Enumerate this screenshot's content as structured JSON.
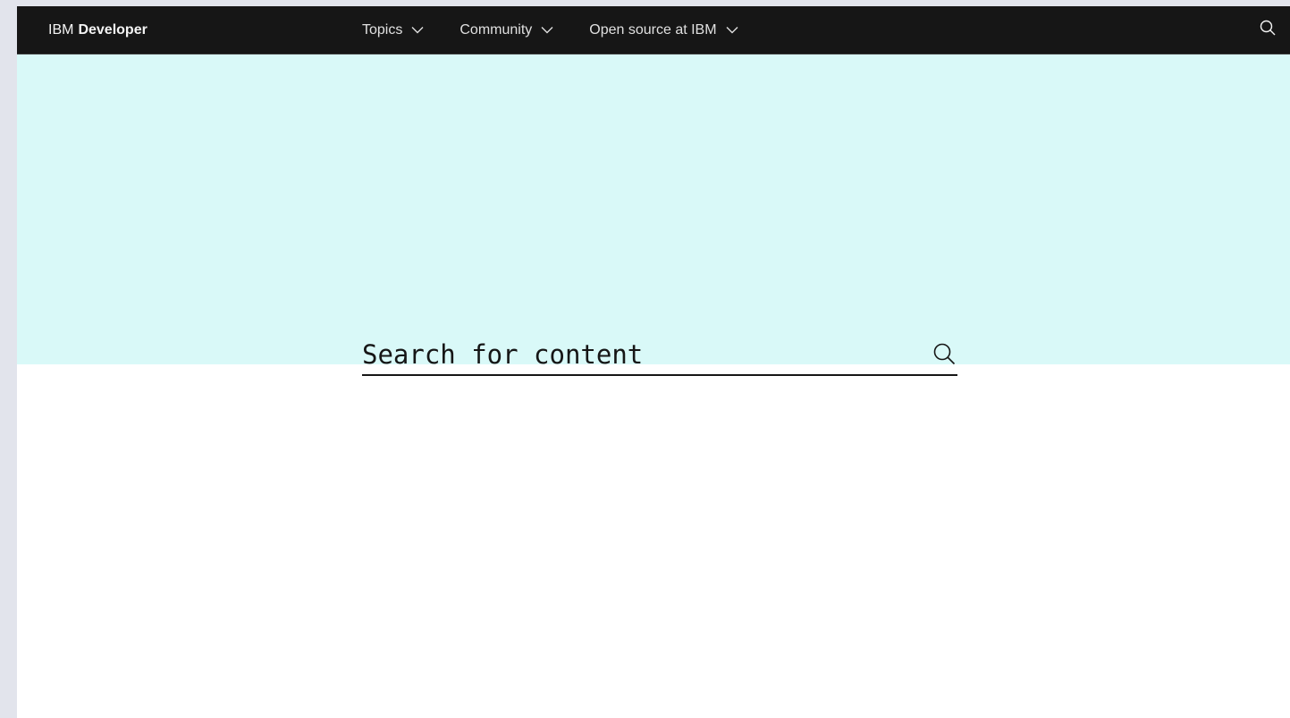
{
  "header": {
    "brand_prefix": "IBM",
    "brand_name": "Developer",
    "nav_items": [
      {
        "label": "Topics",
        "icon": "chevron-down-icon"
      },
      {
        "label": "Community",
        "icon": "chevron-down-icon"
      },
      {
        "label": "Open source at IBM",
        "icon": "chevron-down-icon"
      }
    ],
    "search_icon": "search-icon"
  },
  "hero": {
    "search_placeholder": "Search for content",
    "search_icon": "search-icon"
  },
  "colors": {
    "topbar_bg": "#161616",
    "hero_bg": "#d9f9f8",
    "page_bg": "#ffffff",
    "outer_bg": "#e2e4ec"
  }
}
